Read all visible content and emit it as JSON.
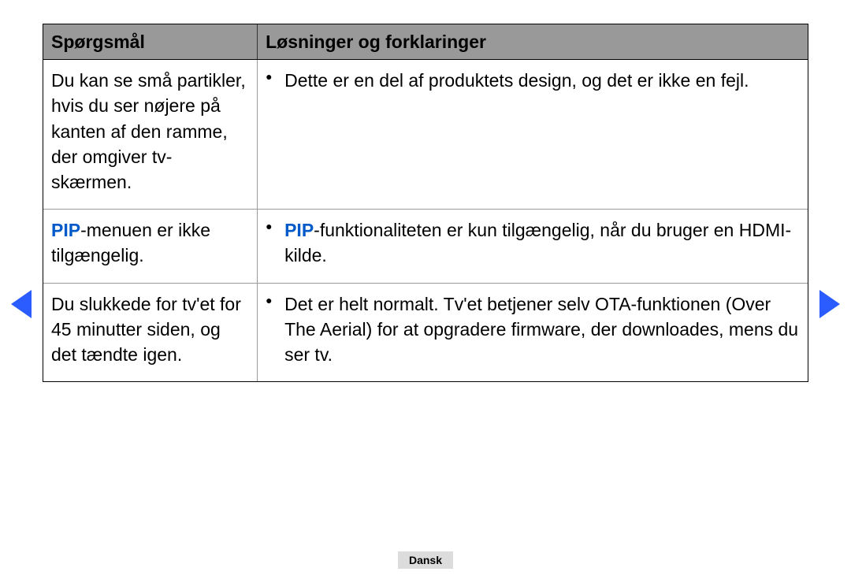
{
  "header": {
    "col_question": "Spørgsmål",
    "col_solution": "Løsninger og forklaringer"
  },
  "rows": [
    {
      "question": "Du kan se små partikler, hvis du ser nøjere på kanten af den ramme, der omgiver tv-skærmen.",
      "solution_pre": "",
      "solution_main": "Dette er en del af produktets design, og det er ikke en fejl."
    },
    {
      "question_pip": "PIP",
      "question_rest": "-menuen er ikke tilgængelig.",
      "solution_pip": "PIP",
      "solution_rest": "-funktionaliteten er kun tilgængelig, når du bruger en HDMI-kilde."
    },
    {
      "question": "Du slukkede for tv'et for 45 minutter siden, og det tændte igen.",
      "solution_main": "Det er helt normalt. Tv'et betjener selv OTA-funktionen (Over The Aerial) for at opgradere firmware, der downloades, mens du ser tv."
    }
  ],
  "footer": {
    "language": "Dansk"
  }
}
